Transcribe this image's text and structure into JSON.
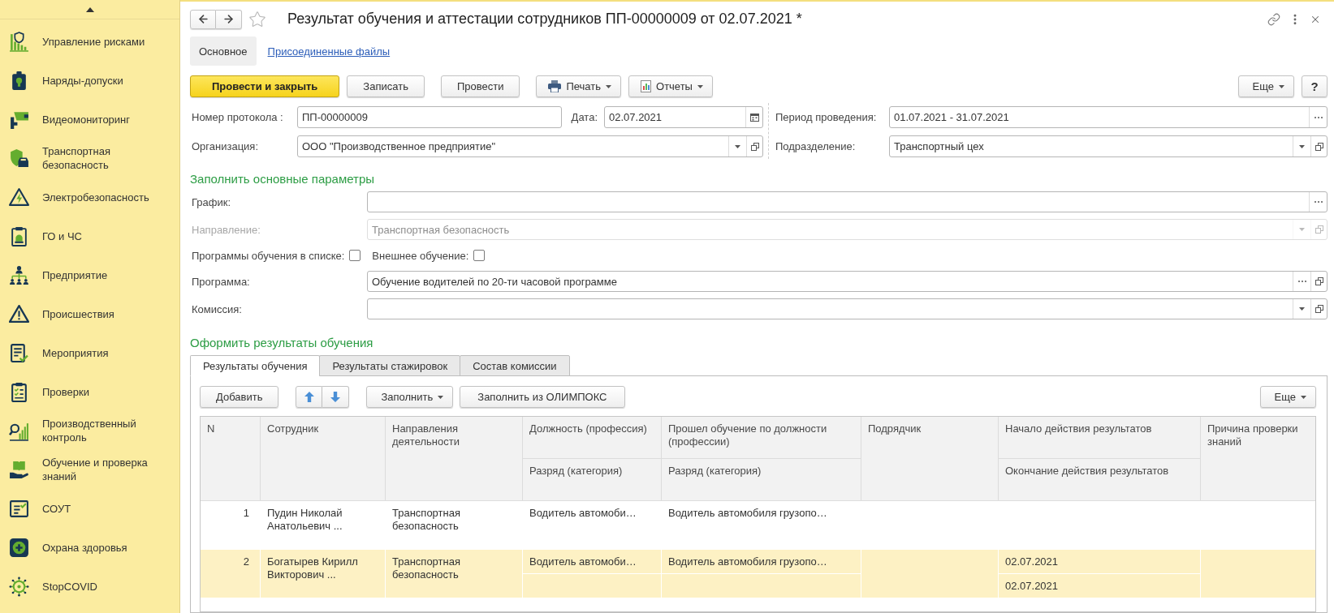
{
  "sidebar": {
    "items": [
      {
        "label": "Управление рисками"
      },
      {
        "label": "Наряды-допуски"
      },
      {
        "label": "Видеомониторинг"
      },
      {
        "label": "Транспортная безопасность"
      },
      {
        "label": "Электробезопасность"
      },
      {
        "label": "ГО и ЧС"
      },
      {
        "label": "Предприятие"
      },
      {
        "label": "Происшествия"
      },
      {
        "label": "Мероприятия"
      },
      {
        "label": "Проверки"
      },
      {
        "label": "Производственный контроль"
      },
      {
        "label": "Обучение и проверка знаний"
      },
      {
        "label": "СОУТ"
      },
      {
        "label": "Охрана здоровья"
      },
      {
        "label": "StopCOVID"
      }
    ]
  },
  "header": {
    "title": "Результат обучения и аттестации сотрудников ПП-00000009 от 02.07.2021 *"
  },
  "form_tabs": [
    {
      "label": "Основное",
      "selected": true
    },
    {
      "label": "Присоединенные файлы",
      "selected": false
    }
  ],
  "toolbar": {
    "groups": [
      [
        {
          "kind": "primary",
          "label": "Провести и закрыть"
        },
        {
          "kind": "plain",
          "label": "Записать"
        }
      ],
      [
        {
          "kind": "plain",
          "label": "Провести"
        }
      ],
      [
        {
          "kind": "print",
          "label": "Печать"
        },
        {
          "kind": "reports",
          "label": "Отчеты"
        }
      ]
    ],
    "right": [
      {
        "kind": "menu",
        "label": "Еще"
      },
      {
        "kind": "help",
        "label": "?"
      }
    ]
  },
  "requisites": [
    {
      "left": [
        {
          "label": "Номер протокола :",
          "value": "ПП-00000009",
          "kind": "text"
        },
        {
          "label": "Дата:",
          "value": "02.07.2021",
          "kind": "date"
        }
      ],
      "right": {
        "label": "Период проведения:",
        "value": "01.07.2021 - 31.07.2021",
        "kind": "select"
      }
    },
    {
      "left": [
        {
          "label": "Организация:",
          "value": "ООО \"Производственное предприятие\"",
          "kind": "combo"
        }
      ],
      "right": {
        "label": "Подразделение:",
        "value": "Транспортный цех",
        "kind": "combo"
      }
    }
  ],
  "params": {
    "title": "Заполнить основные параметры",
    "rows": [
      {
        "kind": "select",
        "label": "График:",
        "disabled": false
      },
      {
        "kind": "combo",
        "label": "Направление:",
        "value": "Транспортная безопасность",
        "disabled": true
      },
      {
        "kind": "checks",
        "disabled": false,
        "items": [
          {
            "label": "Программы обучения в списке:",
            "checked": false
          },
          {
            "label": "Внешнее обучение:",
            "checked": false
          }
        ]
      },
      {
        "kind": "chooser",
        "label": "Программа:",
        "value": "Обучение водителей по 20-ти часовой программе",
        "disabled": false
      },
      {
        "kind": "combo",
        "label": "Комиссия:",
        "disabled": false
      }
    ]
  },
  "results": {
    "title": "Оформить результаты обучения",
    "tabs": [
      {
        "label": "Результаты обучения",
        "selected": true
      },
      {
        "label": "Результаты стажировок",
        "selected": false
      },
      {
        "label": "Состав комиссии",
        "selected": false
      }
    ],
    "toolbar": {
      "groups": [
        [
          {
            "kind": "plain",
            "label": "Добавить"
          }
        ],
        [
          {
            "kind": "move"
          }
        ],
        [
          {
            "kind": "menu",
            "label": "Заполнить"
          },
          {
            "kind": "plain",
            "label": "Заполнить из ОЛИМПОКС"
          }
        ]
      ],
      "right": [
        {
          "kind": "menu",
          "label": "Еще"
        }
      ]
    },
    "table": {
      "columns": [
        {
          "title": "N"
        },
        {
          "title": "Сотрудник"
        },
        {
          "title": "Направления деятельности"
        },
        {
          "title": "Должность (профессия)",
          "subtitle": "Разряд (категория)"
        },
        {
          "title": "Прошел обучение по должности (профессии)",
          "subtitle": "Разряд (категория)"
        },
        {
          "title": "Подрядчик"
        },
        {
          "title": "Начало действия результатов",
          "subtitle": "Окончание действия результатов"
        },
        {
          "title": "Причина проверки знаний"
        }
      ],
      "rows": [
        {
          "selected": false,
          "n": "1",
          "employee": "Пудин Николай Анатольевич ...",
          "activity": "Транспортная безопасность",
          "position": "Водитель автомоби…",
          "trained_position": "Водитель автомобиля грузопо…"
        },
        {
          "selected": true,
          "n": "2",
          "employee": "Богатырев Кирилл Викторович ...",
          "activity": "Транспортная безопасность",
          "position": "Водитель автомоби…",
          "trained_position": "Водитель автомобиля грузопо…",
          "start": "02.07.2021",
          "end": "02.07.2021"
        }
      ]
    }
  }
}
